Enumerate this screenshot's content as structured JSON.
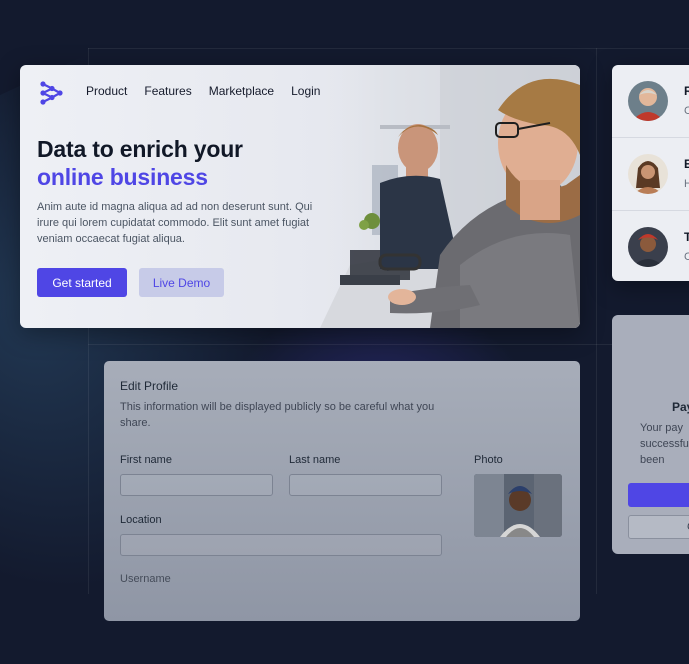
{
  "hero": {
    "nav": [
      "Product",
      "Features",
      "Marketplace",
      "Login"
    ],
    "headline_1": "Data to enrich your",
    "headline_2": "online business",
    "body": "Anim aute id magna aliqua ad ad non deserunt sunt. Qui irure qui lorem cupidatat commodo. Elit sunt amet fugiat veniam occaecat fugiat aliqua.",
    "primary_button": "Get started",
    "secondary_button": "Live Demo",
    "accent_color": "#4f46e5"
  },
  "people": [
    {
      "name": "R",
      "sub": "C"
    },
    {
      "name": "E",
      "sub": "H"
    },
    {
      "name": "T",
      "sub": "C"
    }
  ],
  "profile": {
    "title": "Edit Profile",
    "description": "This information will be displayed publicly so be careful what you share.",
    "first_name_label": "First name",
    "last_name_label": "Last name",
    "photo_label": "Photo",
    "location_label": "Location",
    "username_label": "Username"
  },
  "payment": {
    "title": "Pay",
    "message": "Your pay successful has been",
    "secondary_button": "C"
  }
}
